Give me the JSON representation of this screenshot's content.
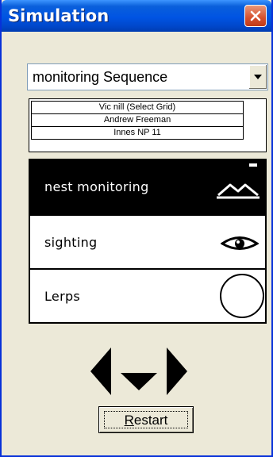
{
  "window": {
    "title": "Simulation",
    "close_icon": "close-x-icon"
  },
  "sequence_select": {
    "value": "monitoring Sequence"
  },
  "info": {
    "rows": [
      "Vic nill (Select Grid)",
      "Andrew Freeman",
      "Innes NP 11"
    ]
  },
  "list": {
    "items": [
      {
        "label": "nest monitoring",
        "icon": "mountain-icon",
        "selected": true
      },
      {
        "label": "sighting",
        "icon": "eye-icon",
        "selected": false
      },
      {
        "label": "Lerps",
        "icon": "circle-icon",
        "selected": false
      }
    ]
  },
  "nav": {
    "icons": [
      "arrow-left-icon",
      "arrow-down-icon",
      "arrow-right-icon"
    ]
  },
  "restart": {
    "label": "Restart"
  },
  "colors": {
    "titlebar": "#0054e3",
    "window_bg": "#ece9d8",
    "close_button": "#d6502e",
    "selected_bg": "#000000"
  }
}
